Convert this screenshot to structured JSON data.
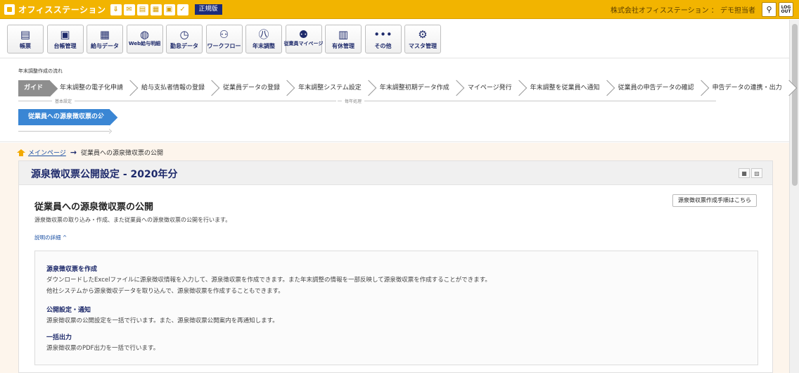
{
  "topbar": {
    "brand": "オフィスステーション",
    "mini_icons": [
      "download-icon",
      "mail-icon",
      "file-icon",
      "calendar-icon",
      "document-icon",
      "check-icon"
    ],
    "edition": "正規版",
    "user": "株式会社オフィスステーション ： デモ担当者",
    "logout": "LOG OUT"
  },
  "menu": [
    {
      "label": "帳票",
      "icon": "form-icon",
      "glyph": "▤"
    },
    {
      "label": "台帳管理",
      "icon": "ledger-icon",
      "glyph": "▣"
    },
    {
      "label": "給与データ",
      "icon": "payroll-data-icon",
      "glyph": "▦"
    },
    {
      "label": "Web給与明細",
      "icon": "web-payslip-icon",
      "glyph": "◍"
    },
    {
      "label": "勤怠データ",
      "icon": "attendance-icon",
      "glyph": "◷"
    },
    {
      "label": "ワークフロー",
      "icon": "workflow-icon",
      "glyph": "⚇"
    },
    {
      "label": "年末調整",
      "icon": "year-end-icon",
      "glyph": "㊇"
    },
    {
      "label": "従業員マイページ",
      "icon": "employee-mypage-icon",
      "glyph": "⚉"
    },
    {
      "label": "有休管理",
      "icon": "paid-leave-icon",
      "glyph": "▥"
    },
    {
      "label": "その他",
      "icon": "more-icon",
      "glyph": "•••"
    },
    {
      "label": "マスタ管理",
      "icon": "master-settings-icon",
      "glyph": "⚙"
    }
  ],
  "flow": {
    "title": "年末調整作成の流れ",
    "guide": "ガイド",
    "steps": [
      "年末調整の電子化申請",
      "給与支払者情報の登録",
      "従業員データの登録",
      "年末調整システム設定",
      "年末調整初期データ作成",
      "マイページ発行",
      "年末調整を従業員へ通知",
      "従業員の申告データの確認",
      "申告データの連携・出力"
    ],
    "phase_basic": "基本設定",
    "phase_yearly": "毎年処理",
    "active_step": "従業員への源泉徴収票の公開"
  },
  "breadcrumb": {
    "home": "メインページ",
    "current": "従業員への源泉徴収票の公開"
  },
  "panel": {
    "title": "源泉徴収票公開設定 - 2020年分",
    "section_title": "従業員への源泉徴収票の公開",
    "manual_button": "源泉徴収票作成手順はこちら",
    "description": "源泉徴収票の取り込み・作成、また従業員への源泉徴収票の公開を行います。",
    "toggle": "説明の詳細 ^",
    "details": [
      {
        "title": "源泉徴収票を作成",
        "lines": [
          "ダウンロードしたExcelファイルに源泉徴収情報を入力して、源泉徴収票を作成できます。また年末調整の情報を一部反映して源泉徴収票を作成することができます。",
          "他社システムから源泉徴収データを取り込んで、源泉徴収票を作成することもできます。"
        ]
      },
      {
        "title": "公開設定・通知",
        "lines": [
          "源泉徴収票の公開設定を一括で行います。また、源泉徴収票公開案内を再通知します。"
        ]
      },
      {
        "title": "一括出力",
        "lines": [
          "源泉徴収票のPDF出力を一括で行います。"
        ]
      }
    ]
  }
}
